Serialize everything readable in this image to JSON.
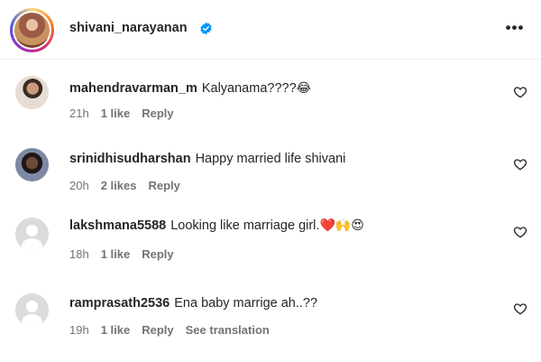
{
  "post": {
    "username": "shivani_narayanan",
    "verified_icon": "verified-badge-icon",
    "more_icon": "more-options-icon",
    "more_label": "•••"
  },
  "comments": [
    {
      "username": "mahendravarman_m",
      "text": "Kalyanama????",
      "emoji": "😂",
      "time": "21h",
      "likes": "1 like",
      "reply": "Reply",
      "avatar": "user-photo"
    },
    {
      "username": "srinidhisudharshan",
      "text": "Happy married life shivani",
      "emoji": "",
      "time": "20h",
      "likes": "2 likes",
      "reply": "Reply",
      "avatar": "user-photo"
    },
    {
      "username": "lakshmana5588",
      "text": "Looking like marriage girl.",
      "emoji": "❤️🙌😍",
      "time": "18h",
      "likes": "1 like",
      "reply": "Reply",
      "avatar": "default-avatar"
    },
    {
      "username": "ramprasath2536",
      "text": "Ena baby marrige ah..??",
      "emoji": "",
      "time": "19h",
      "likes": "1 like",
      "reply": "Reply",
      "see_translation": "See translation",
      "avatar": "default-avatar"
    }
  ],
  "colors": {
    "text": "#262626",
    "secondary": "#737373",
    "verified": "#0095f6"
  }
}
